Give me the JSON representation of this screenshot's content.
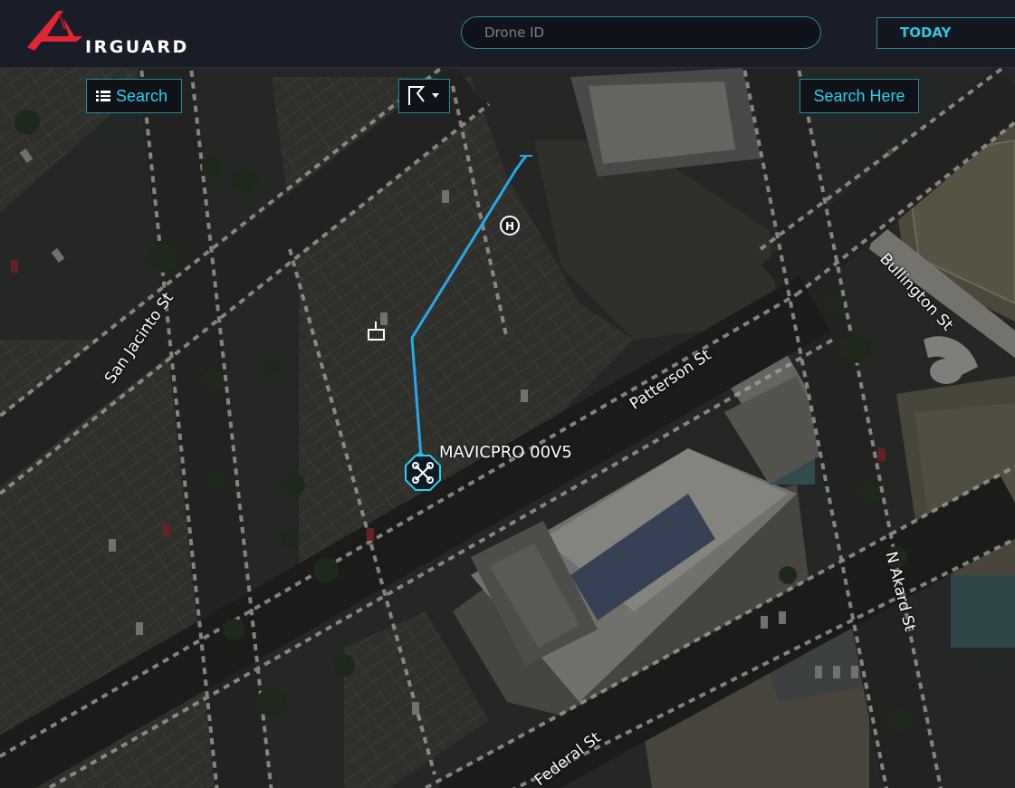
{
  "header": {
    "logo_text": "IRGUARD",
    "drone_search": {
      "placeholder": "Drone ID",
      "value": ""
    },
    "date_range": "TODAY"
  },
  "map": {
    "search_button": "Search",
    "search_here_button": "Search Here",
    "streets": {
      "san_jacinto": "San Jacinto St",
      "patterson": "Patterson St",
      "bullington": "Bullington St",
      "n_akard": "N Akard St",
      "federal": "Federal St"
    },
    "drone": {
      "name": "MAVICPRO 00V5",
      "track_color": "#29a8e6",
      "accent_color": "#2fd0ea"
    }
  },
  "colors": {
    "brand": "#e02733",
    "accent": "#2fc7e0",
    "header_bg": "#1a1c27"
  }
}
